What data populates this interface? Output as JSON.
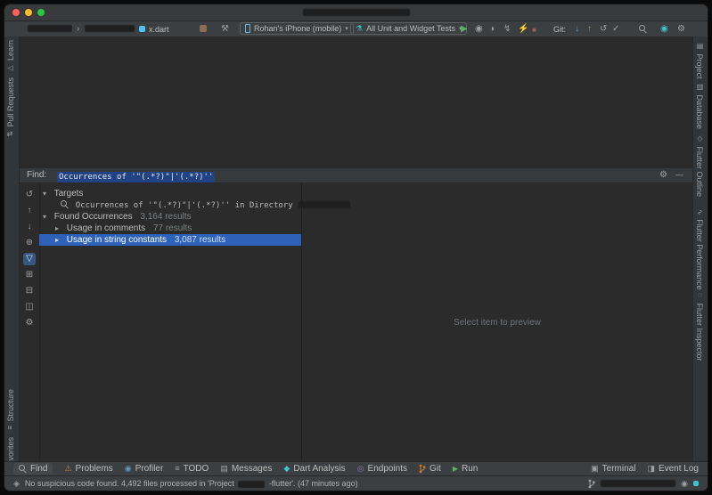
{
  "toolbar": {
    "file_name": "x.dart",
    "device": "Rohan's iPhone (mobile)",
    "run_config": "All Unit and Widget Tests",
    "git_label": "Git:"
  },
  "left_stripe": {
    "top": [
      "Learn",
      "Pull Requests"
    ],
    "bottom": [
      "Structure",
      "Favorites"
    ]
  },
  "right_stripe": [
    "Project",
    "Database",
    "Flutter Outline",
    "Flutter Performance",
    "Flutter Inspector"
  ],
  "find_panel": {
    "label": "Find:",
    "query": "Occurrences of '\"(.*?)\"|'(.*?)''"
  },
  "tree": {
    "targets": "Targets",
    "occurrence": "Occurrences of '\"(.*?)\"|'(.*?)'' in Directory",
    "found": "Found Occurrences",
    "found_count": "3,164 results",
    "comments": "Usage in comments",
    "comments_count": "77 results",
    "strings": "Usage in string constants",
    "strings_count": "3,087 results"
  },
  "preview": {
    "placeholder": "Select item to preview"
  },
  "bottom_bar": {
    "left": [
      "Find",
      "Problems",
      "Profiler",
      "TODO",
      "Messages",
      "Dart Analysis",
      "Endpoints",
      "Git",
      "Run"
    ],
    "right": [
      "Terminal",
      "Event Log"
    ]
  },
  "status": {
    "before": "No suspicious code found. 4,492 files processed in 'Project",
    "after": "-flutter'. (47 minutes ago)"
  },
  "icons": {
    "chevron": "›",
    "dropdown": "▾",
    "hammer": "⚒",
    "flask": "⚗",
    "run": "▶",
    "debug": "◉",
    "profile": "◑",
    "attach": "↯",
    "hot_reload": "⚡",
    "stop": "■",
    "vcs_update": "↓",
    "vcs_push": "↑",
    "vcs_history": "↺",
    "vcs_check": "✓",
    "gear": "⚙",
    "minimize": "—",
    "expanded": "▾",
    "collapsed": "▸",
    "refresh": "↺",
    "up": "↑",
    "down": "↓",
    "locate": "⊕",
    "filter": "▽",
    "expand_all": "⊞",
    "collapse_all": "⊟",
    "preview_toggle": "◫",
    "problems": "⚠",
    "profiler": "◉",
    "todo": "≡",
    "messages": "▤",
    "dart": "◆",
    "endpoints": "◎",
    "run_small": "▶",
    "terminal": "▣",
    "event_log": "◨",
    "learn": "▷",
    "pull_requests": "⇅",
    "structure": "≡",
    "favorites": "★",
    "project": "▤",
    "database": "▥",
    "flutter_outline": "◇",
    "flutter_performance": "∿",
    "flutter_inspector": "◌",
    "inspections": "◈",
    "notifications": "◉"
  },
  "colors": {
    "selection_row": "#2e62b8",
    "find_selection": "#214283",
    "run_green": "#5caf5f",
    "reload_yellow": "#d9a343",
    "stop_red": "#9d5a5a",
    "accent_cyan": "#3ec3cf",
    "panel_bg": "#3c3f41",
    "editor_bg": "#2b2b2b"
  }
}
